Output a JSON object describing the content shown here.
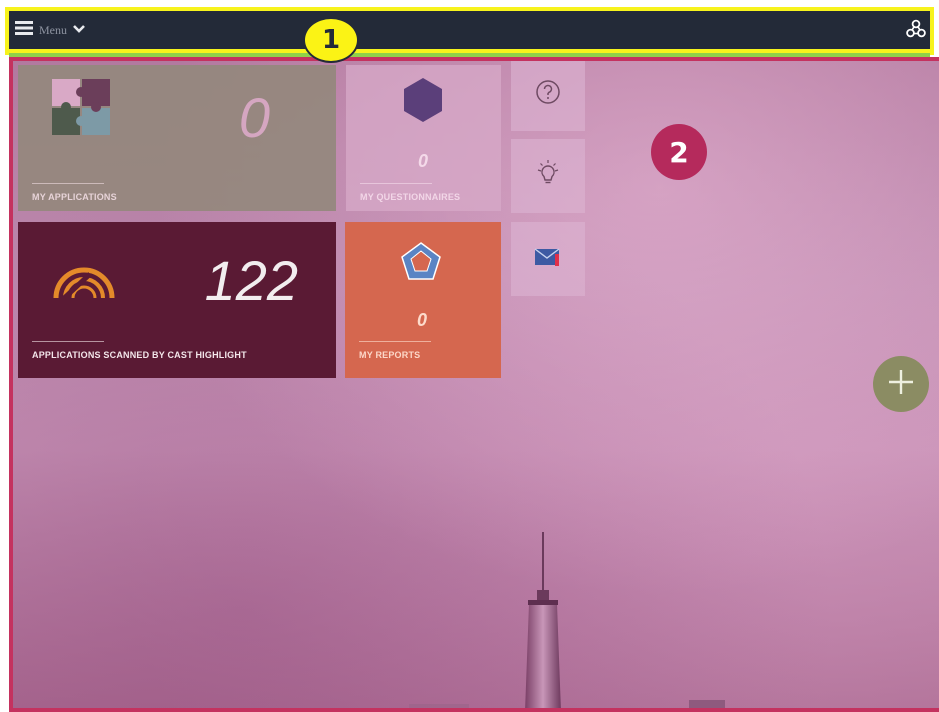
{
  "annotations": {
    "callout_1": "1",
    "callout_2": "2"
  },
  "header": {
    "menu_label": "Menu"
  },
  "tiles": {
    "my_applications": {
      "count": "0",
      "label": "MY APPLICATIONS"
    },
    "my_questionnaires": {
      "count": "0",
      "label": "MY QUESTIONNAIRES"
    },
    "applications_scanned": {
      "count": "122",
      "label": "APPLICATIONS SCANNED BY CAST HIGHLIGHT"
    },
    "my_reports": {
      "count": "0",
      "label": "MY REPORTS"
    }
  },
  "icons": {
    "menu": "hamburger-icon",
    "menu_expand": "chevron-down-icon",
    "logo": "recycle-triangle-icon",
    "applications": "puzzle-icon",
    "questionnaires": "hexagon-icon",
    "scanned": "gauge-icon",
    "reports": "pentagon-radar-icon",
    "help": "question-circle-icon",
    "ideas": "lightbulb-icon",
    "messages": "mail-icon",
    "add": "plus-icon"
  },
  "colors": {
    "topbar": "#232a38",
    "region_1_outline": "#f7f31c",
    "region_2_outline": "#c4325f",
    "tile_scanned": "#5a1a34",
    "tile_reports": "#d5674f",
    "fab": "#8b8c63"
  }
}
